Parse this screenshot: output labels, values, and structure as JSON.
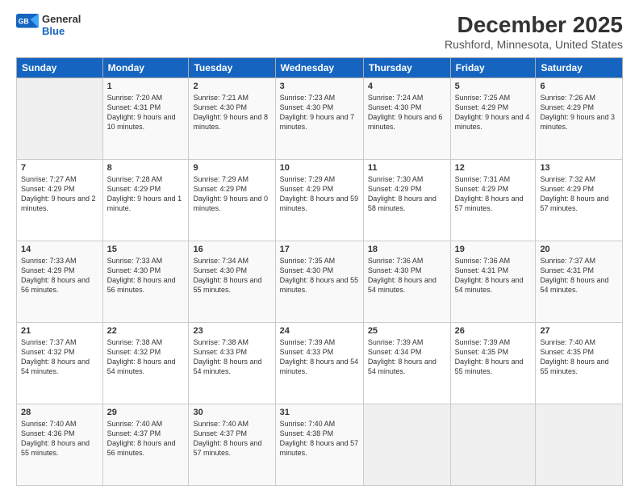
{
  "header": {
    "logo_general": "General",
    "logo_blue": "Blue",
    "main_title": "December 2025",
    "subtitle": "Rushford, Minnesota, United States"
  },
  "days_of_week": [
    "Sunday",
    "Monday",
    "Tuesday",
    "Wednesday",
    "Thursday",
    "Friday",
    "Saturday"
  ],
  "weeks": [
    [
      {
        "day": "",
        "sunrise": "",
        "sunset": "",
        "daylight": ""
      },
      {
        "day": "1",
        "sunrise": "Sunrise: 7:20 AM",
        "sunset": "Sunset: 4:31 PM",
        "daylight": "Daylight: 9 hours and 10 minutes."
      },
      {
        "day": "2",
        "sunrise": "Sunrise: 7:21 AM",
        "sunset": "Sunset: 4:30 PM",
        "daylight": "Daylight: 9 hours and 8 minutes."
      },
      {
        "day": "3",
        "sunrise": "Sunrise: 7:23 AM",
        "sunset": "Sunset: 4:30 PM",
        "daylight": "Daylight: 9 hours and 7 minutes."
      },
      {
        "day": "4",
        "sunrise": "Sunrise: 7:24 AM",
        "sunset": "Sunset: 4:30 PM",
        "daylight": "Daylight: 9 hours and 6 minutes."
      },
      {
        "day": "5",
        "sunrise": "Sunrise: 7:25 AM",
        "sunset": "Sunset: 4:29 PM",
        "daylight": "Daylight: 9 hours and 4 minutes."
      },
      {
        "day": "6",
        "sunrise": "Sunrise: 7:26 AM",
        "sunset": "Sunset: 4:29 PM",
        "daylight": "Daylight: 9 hours and 3 minutes."
      }
    ],
    [
      {
        "day": "7",
        "sunrise": "Sunrise: 7:27 AM",
        "sunset": "Sunset: 4:29 PM",
        "daylight": "Daylight: 9 hours and 2 minutes."
      },
      {
        "day": "8",
        "sunrise": "Sunrise: 7:28 AM",
        "sunset": "Sunset: 4:29 PM",
        "daylight": "Daylight: 9 hours and 1 minute."
      },
      {
        "day": "9",
        "sunrise": "Sunrise: 7:29 AM",
        "sunset": "Sunset: 4:29 PM",
        "daylight": "Daylight: 9 hours and 0 minutes."
      },
      {
        "day": "10",
        "sunrise": "Sunrise: 7:29 AM",
        "sunset": "Sunset: 4:29 PM",
        "daylight": "Daylight: 8 hours and 59 minutes."
      },
      {
        "day": "11",
        "sunrise": "Sunrise: 7:30 AM",
        "sunset": "Sunset: 4:29 PM",
        "daylight": "Daylight: 8 hours and 58 minutes."
      },
      {
        "day": "12",
        "sunrise": "Sunrise: 7:31 AM",
        "sunset": "Sunset: 4:29 PM",
        "daylight": "Daylight: 8 hours and 57 minutes."
      },
      {
        "day": "13",
        "sunrise": "Sunrise: 7:32 AM",
        "sunset": "Sunset: 4:29 PM",
        "daylight": "Daylight: 8 hours and 57 minutes."
      }
    ],
    [
      {
        "day": "14",
        "sunrise": "Sunrise: 7:33 AM",
        "sunset": "Sunset: 4:29 PM",
        "daylight": "Daylight: 8 hours and 56 minutes."
      },
      {
        "day": "15",
        "sunrise": "Sunrise: 7:33 AM",
        "sunset": "Sunset: 4:30 PM",
        "daylight": "Daylight: 8 hours and 56 minutes."
      },
      {
        "day": "16",
        "sunrise": "Sunrise: 7:34 AM",
        "sunset": "Sunset: 4:30 PM",
        "daylight": "Daylight: 8 hours and 55 minutes."
      },
      {
        "day": "17",
        "sunrise": "Sunrise: 7:35 AM",
        "sunset": "Sunset: 4:30 PM",
        "daylight": "Daylight: 8 hours and 55 minutes."
      },
      {
        "day": "18",
        "sunrise": "Sunrise: 7:36 AM",
        "sunset": "Sunset: 4:30 PM",
        "daylight": "Daylight: 8 hours and 54 minutes."
      },
      {
        "day": "19",
        "sunrise": "Sunrise: 7:36 AM",
        "sunset": "Sunset: 4:31 PM",
        "daylight": "Daylight: 8 hours and 54 minutes."
      },
      {
        "day": "20",
        "sunrise": "Sunrise: 7:37 AM",
        "sunset": "Sunset: 4:31 PM",
        "daylight": "Daylight: 8 hours and 54 minutes."
      }
    ],
    [
      {
        "day": "21",
        "sunrise": "Sunrise: 7:37 AM",
        "sunset": "Sunset: 4:32 PM",
        "daylight": "Daylight: 8 hours and 54 minutes."
      },
      {
        "day": "22",
        "sunrise": "Sunrise: 7:38 AM",
        "sunset": "Sunset: 4:32 PM",
        "daylight": "Daylight: 8 hours and 54 minutes."
      },
      {
        "day": "23",
        "sunrise": "Sunrise: 7:38 AM",
        "sunset": "Sunset: 4:33 PM",
        "daylight": "Daylight: 8 hours and 54 minutes."
      },
      {
        "day": "24",
        "sunrise": "Sunrise: 7:39 AM",
        "sunset": "Sunset: 4:33 PM",
        "daylight": "Daylight: 8 hours and 54 minutes."
      },
      {
        "day": "25",
        "sunrise": "Sunrise: 7:39 AM",
        "sunset": "Sunset: 4:34 PM",
        "daylight": "Daylight: 8 hours and 54 minutes."
      },
      {
        "day": "26",
        "sunrise": "Sunrise: 7:39 AM",
        "sunset": "Sunset: 4:35 PM",
        "daylight": "Daylight: 8 hours and 55 minutes."
      },
      {
        "day": "27",
        "sunrise": "Sunrise: 7:40 AM",
        "sunset": "Sunset: 4:35 PM",
        "daylight": "Daylight: 8 hours and 55 minutes."
      }
    ],
    [
      {
        "day": "28",
        "sunrise": "Sunrise: 7:40 AM",
        "sunset": "Sunset: 4:36 PM",
        "daylight": "Daylight: 8 hours and 55 minutes."
      },
      {
        "day": "29",
        "sunrise": "Sunrise: 7:40 AM",
        "sunset": "Sunset: 4:37 PM",
        "daylight": "Daylight: 8 hours and 56 minutes."
      },
      {
        "day": "30",
        "sunrise": "Sunrise: 7:40 AM",
        "sunset": "Sunset: 4:37 PM",
        "daylight": "Daylight: 8 hours and 57 minutes."
      },
      {
        "day": "31",
        "sunrise": "Sunrise: 7:40 AM",
        "sunset": "Sunset: 4:38 PM",
        "daylight": "Daylight: 8 hours and 57 minutes."
      },
      {
        "day": "",
        "sunrise": "",
        "sunset": "",
        "daylight": ""
      },
      {
        "day": "",
        "sunrise": "",
        "sunset": "",
        "daylight": ""
      },
      {
        "day": "",
        "sunrise": "",
        "sunset": "",
        "daylight": ""
      }
    ]
  ]
}
